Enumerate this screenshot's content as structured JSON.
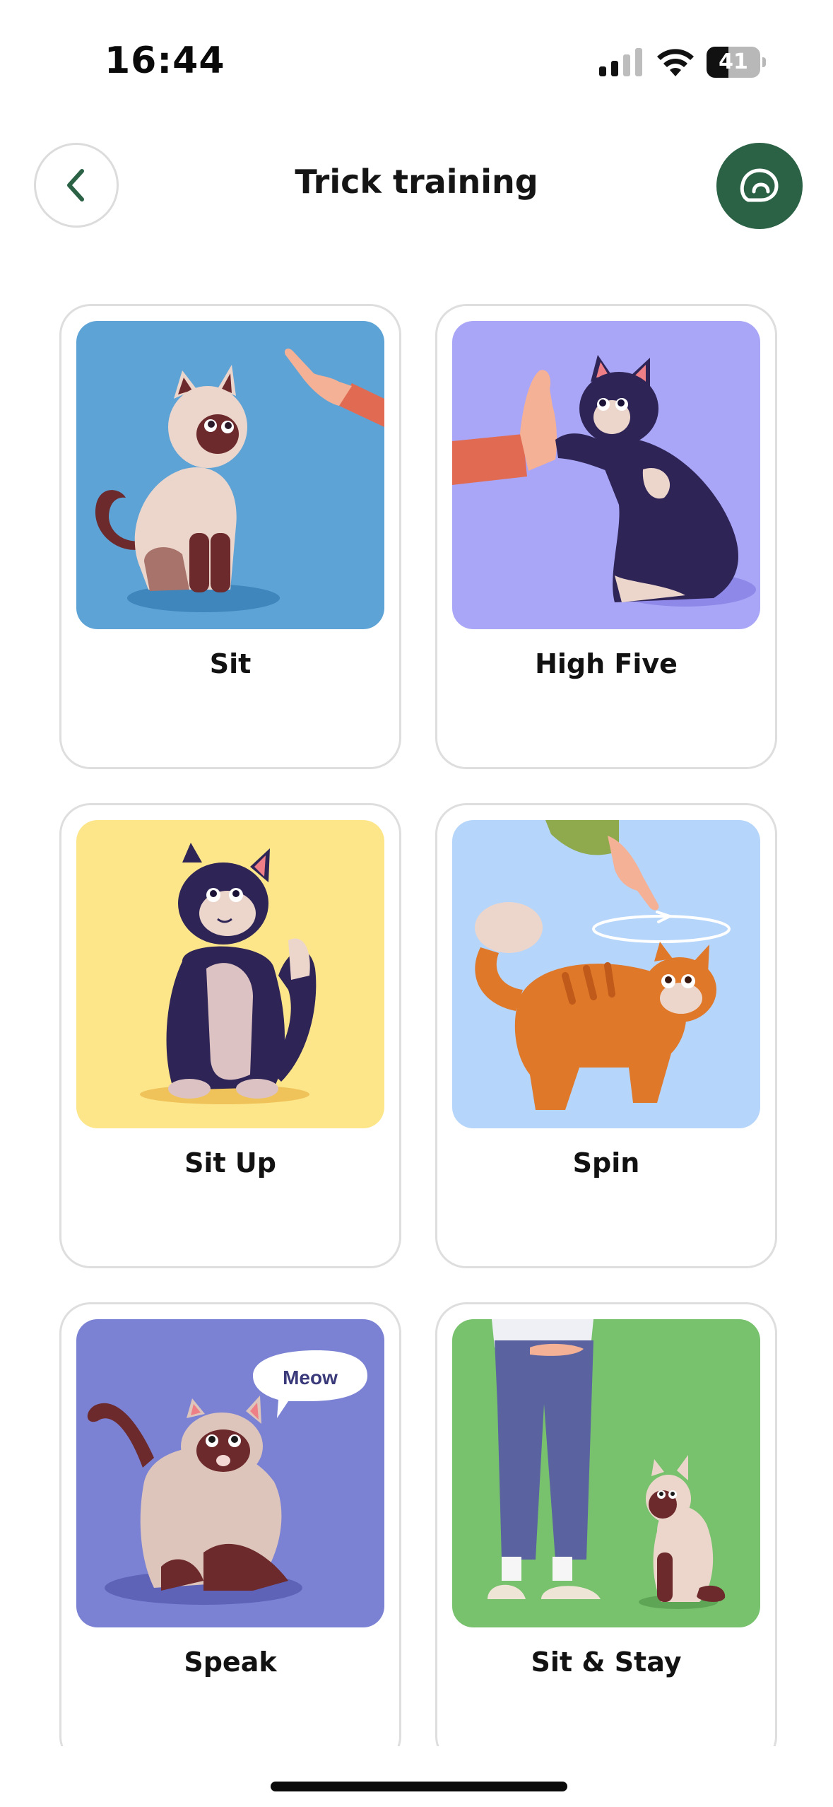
{
  "status_bar": {
    "time": "16:44",
    "battery_level": "41",
    "battery_fraction": 0.41,
    "signal_icon": "cellular-signal-icon",
    "wifi_icon": "wifi-icon"
  },
  "header": {
    "title": "Trick training",
    "back_icon": "chevron-left-icon",
    "chat_icon": "chat-bubble-icon",
    "accent_color": "#2b6246"
  },
  "tricks": [
    {
      "label": "Sit",
      "background": "#5ea3d6",
      "illustration": "siamese-cat-sitting-with-pointing-hand"
    },
    {
      "label": "High Five",
      "background": "#a9a6f7",
      "illustration": "black-cat-high-five-with-hand"
    },
    {
      "label": "Sit Up",
      "background": "#fde68a",
      "illustration": "black-cat-sitting-up"
    },
    {
      "label": "Spin",
      "background": "#b5d5fb",
      "illustration": "orange-tabby-cat-spinning"
    },
    {
      "label": "Speak",
      "background": "#7b82d3",
      "illustration": "siamese-cat-meowing",
      "speech_bubble": "Meow"
    },
    {
      "label": "Sit & Stay",
      "background": "#78c26e",
      "illustration": "siamese-cat-sitting-next-to-person"
    }
  ]
}
